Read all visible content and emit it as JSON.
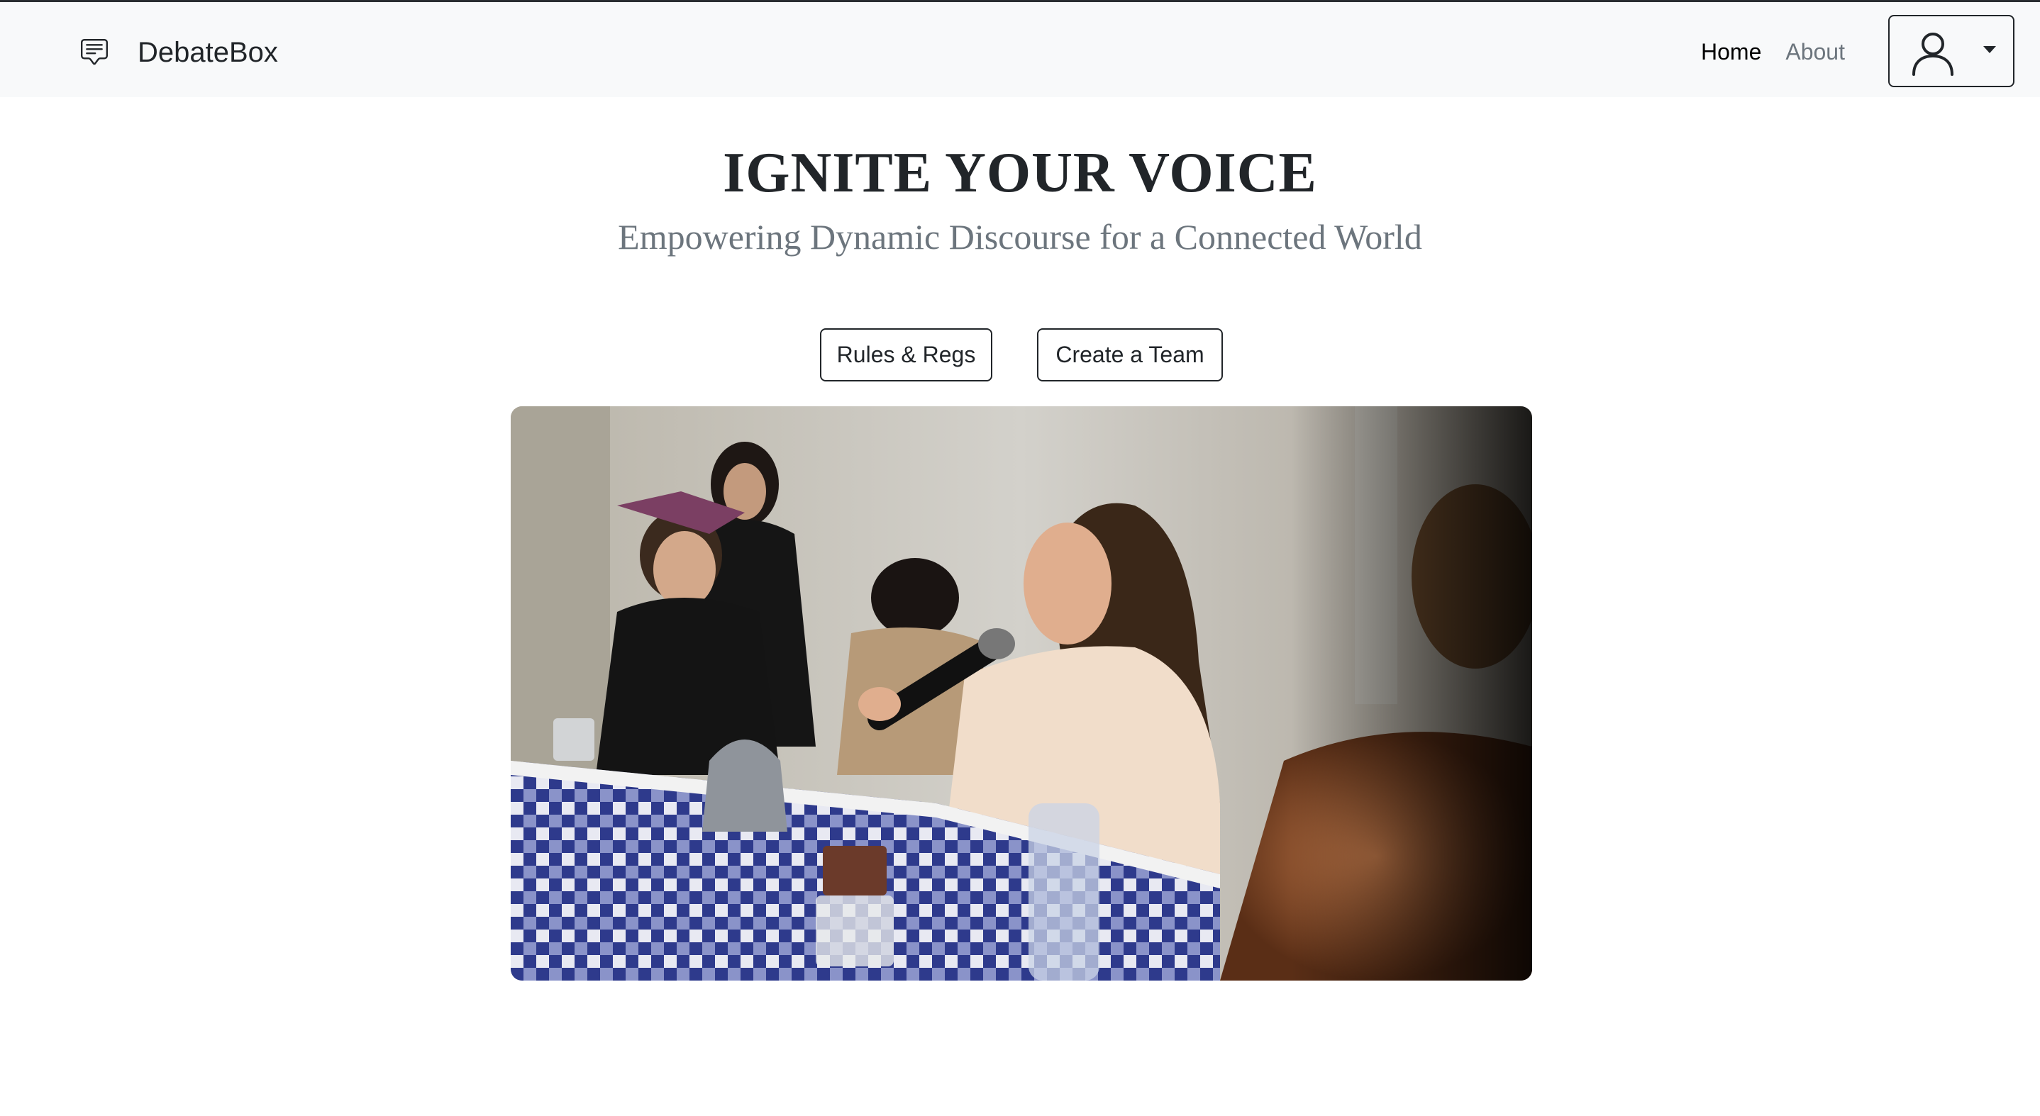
{
  "navbar": {
    "brand_icon": "chat-square-text-icon",
    "brand_name": "DebateBox",
    "links": [
      {
        "label": "Home",
        "active": true
      },
      {
        "label": "About",
        "active": false
      }
    ],
    "user_menu_icon": "person-icon",
    "dropdown_icon": "caret-down-icon"
  },
  "hero": {
    "title": "IGNITE YOUR VOICE",
    "subtitle": "Empowering Dynamic Discourse for a Connected World",
    "buttons": {
      "rules": "Rules & Regs",
      "team": "Create a Team"
    }
  },
  "colors": {
    "navbar_bg": "#f8f9fa",
    "text_dark": "#212529",
    "text_muted": "#6c757d"
  }
}
